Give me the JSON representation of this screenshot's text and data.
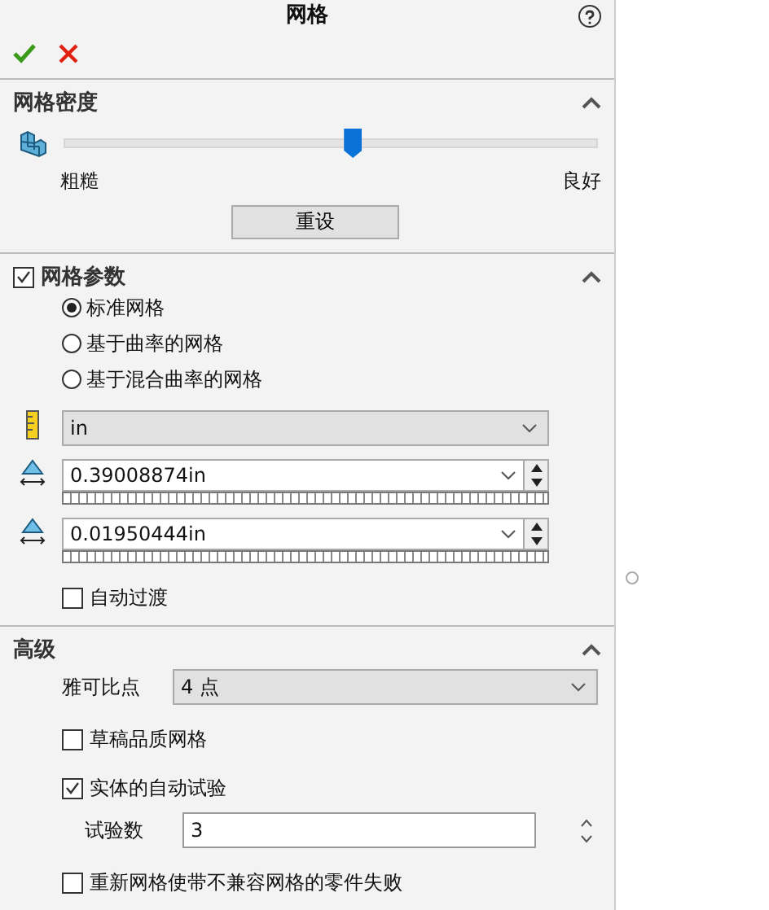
{
  "title": "网格",
  "density": {
    "title": "网格密度",
    "expanded": true,
    "level": 0.54,
    "low_label": "粗糙",
    "high_label": "良好",
    "reset": "重设"
  },
  "parameters": {
    "title": "网格参数",
    "checked": true,
    "expanded": true,
    "mesh_types": [
      {
        "label": "标准网格",
        "selected": true
      },
      {
        "label": "基于曲率的网格",
        "selected": false
      },
      {
        "label": "基于混合曲率的网格",
        "selected": false
      }
    ],
    "unit": "in",
    "element_size": "0.39008874in",
    "tolerance": "0.01950444in",
    "auto_transition": {
      "label": "自动过渡",
      "checked": false
    }
  },
  "advanced": {
    "title": "高级",
    "expanded": true,
    "jacobian_label": "雅可比点",
    "jacobian": "4 点",
    "options": [
      {
        "label": "草稿品质网格",
        "checked": false
      },
      {
        "label": "实体的自动试验",
        "checked": true
      }
    ],
    "trials_label": "试验数",
    "trials": "3",
    "remesh": {
      "label": "重新网格使带不兼容网格的零件失败",
      "checked": false
    }
  }
}
